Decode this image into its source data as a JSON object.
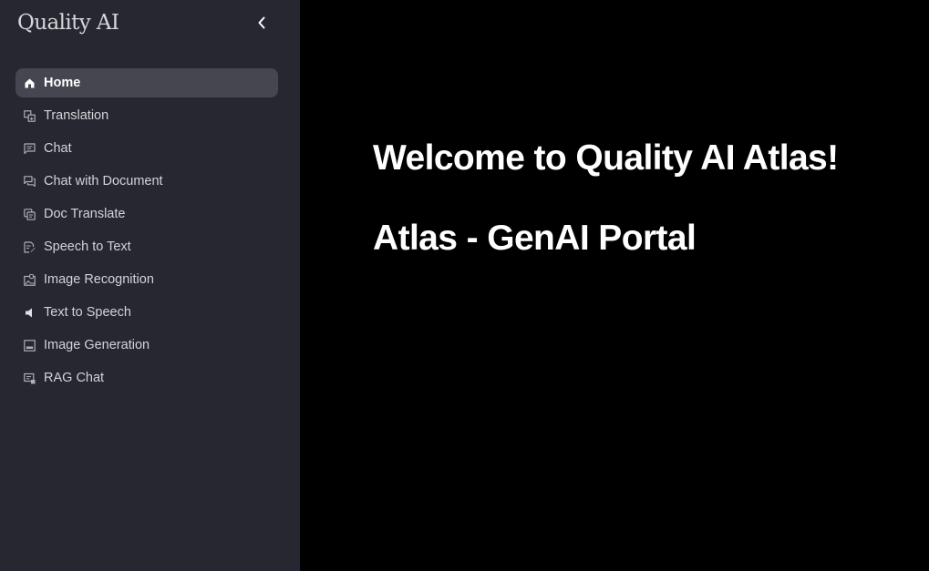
{
  "sidebar": {
    "logo_text": "Quality AI",
    "collapse_icon": "chevron-left-icon",
    "items": [
      {
        "label": "Home",
        "icon": "home-icon",
        "active": true
      },
      {
        "label": "Translation",
        "icon": "translate-icon",
        "active": false
      },
      {
        "label": "Chat",
        "icon": "chat-icon",
        "active": false
      },
      {
        "label": "Chat with Document",
        "icon": "chat-document-icon",
        "active": false
      },
      {
        "label": "Doc Translate",
        "icon": "doc-translate-icon",
        "active": false
      },
      {
        "label": "Speech to Text",
        "icon": "speech-to-text-icon",
        "active": false
      },
      {
        "label": "Image Recognition",
        "icon": "image-recognition-icon",
        "active": false
      },
      {
        "label": "Text to Speech",
        "icon": "speaker-icon",
        "active": false
      },
      {
        "label": "Image Generation",
        "icon": "image-icon",
        "active": false
      },
      {
        "label": "RAG Chat",
        "icon": "rag-chat-icon",
        "active": false
      }
    ]
  },
  "main": {
    "welcome_heading": "Welcome to Quality AI Atlas!",
    "subtitle_heading": "Atlas - GenAI Portal"
  },
  "colors": {
    "sidebar_bg": "#262730",
    "active_item_bg": "#454650",
    "main_bg": "#000000",
    "text": "#ffffff"
  }
}
